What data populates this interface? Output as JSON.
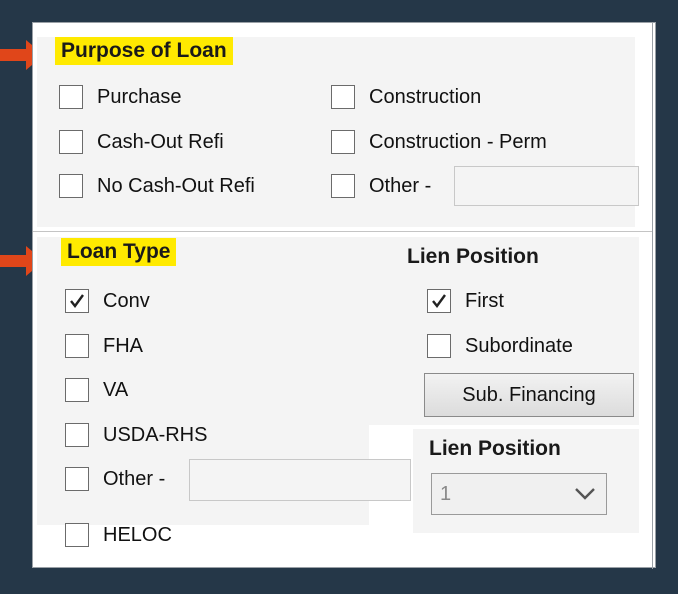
{
  "purpose": {
    "title": "Purpose of Loan",
    "options": [
      {
        "label": "Purchase",
        "checked": false
      },
      {
        "label": "Cash-Out Refi",
        "checked": false
      },
      {
        "label": "No Cash-Out Refi",
        "checked": false
      },
      {
        "label": "Construction",
        "checked": false
      },
      {
        "label": "Construction - Perm",
        "checked": false
      },
      {
        "label": "Other -",
        "checked": false
      }
    ],
    "other_value": ""
  },
  "loan_type": {
    "title": "Loan Type",
    "options": [
      {
        "label": "Conv",
        "checked": true
      },
      {
        "label": "FHA",
        "checked": false
      },
      {
        "label": "VA",
        "checked": false
      },
      {
        "label": "USDA-RHS",
        "checked": false
      },
      {
        "label": "Other -",
        "checked": false
      },
      {
        "label": "HELOC",
        "checked": false
      }
    ],
    "other_value": ""
  },
  "lien": {
    "title": "Lien Position",
    "options": [
      {
        "label": "First",
        "checked": true
      },
      {
        "label": "Subordinate",
        "checked": false
      }
    ],
    "sub_financing_label": "Sub. Financing",
    "select_title": "Lien Position",
    "select_value": "1"
  },
  "colors": {
    "background": "#253748",
    "highlight": "#ffea00",
    "arrow": "#e0461a"
  }
}
